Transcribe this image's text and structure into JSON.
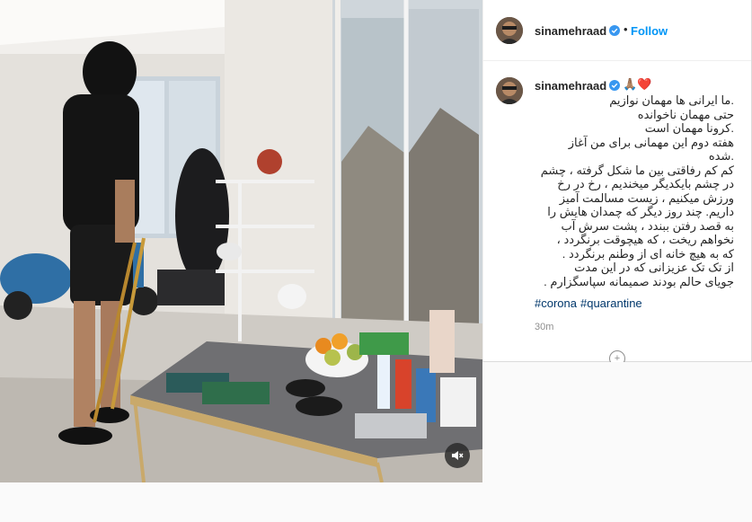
{
  "header": {
    "username": "sinamehraad",
    "separator": "•",
    "follow_label": "Follow"
  },
  "caption": {
    "username": "sinamehraad",
    "emoji": "🙏🏽❤️",
    "lines": [
      ".ما ایرانی ها مهمان نوازیم",
      "حتی مهمان ناخوانده",
      ".کرونا مهمان است",
      "هفته دوم این مهمانی برای من آغاز",
      ".شده",
      "کم کم رفاقتی بین ما شکل گرفته ، چشم",
      "در چشم بایکدیگر میخندیم ، رخ در رخ",
      "ورزش میکنیم ، زیست مسالمت آمیز",
      "داریم. چند روز دیگر که چمدان هایش را",
      "به قصد رفتن ببندد ، پشت سرش آب",
      "نخواهم ریخت ، که هیچوقت برنگردد ،",
      "که به هیچ خانه ای از وطنم برنگردد .",
      "از تک تک عزیزانی که در این مدت",
      "جویای حالم بودند صمیمانه سپاسگزارم ."
    ],
    "hashtags": [
      "#corona",
      "#quarantine"
    ]
  },
  "post": {
    "time_ago": "30m"
  },
  "icons": {
    "verified": "verified-badge-icon",
    "mute": "speaker-muted-icon",
    "load_more": "plus-circle-icon"
  },
  "colors": {
    "link": "#0095f6",
    "hashtag": "#00376b",
    "muted_text": "#8e8e8e",
    "verified": "#3897f0"
  }
}
